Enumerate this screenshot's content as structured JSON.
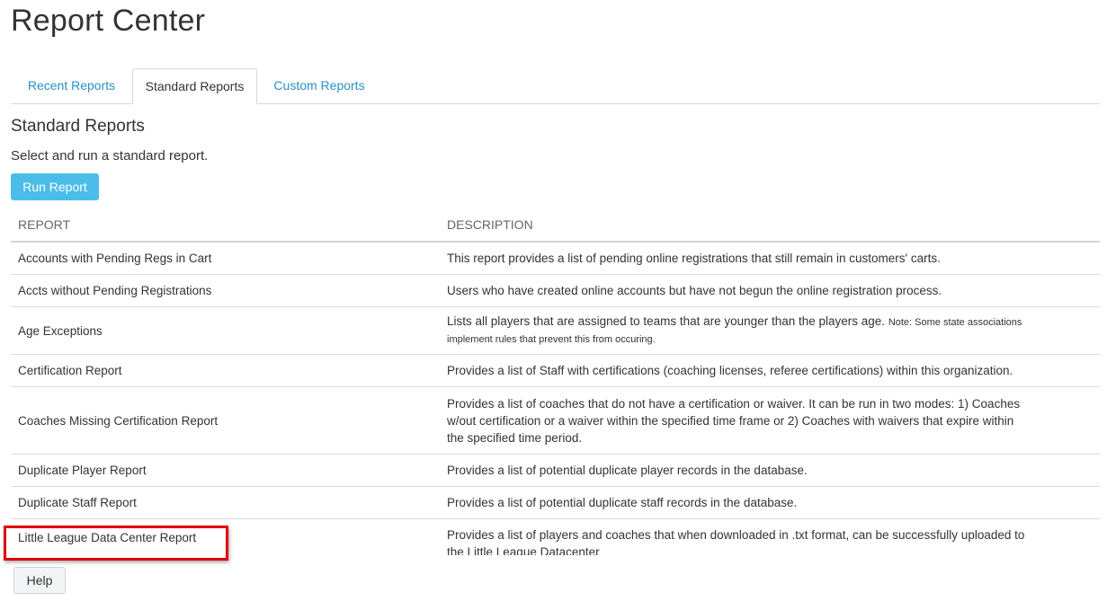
{
  "page": {
    "title": "Report Center"
  },
  "tabs": [
    {
      "label": "Recent Reports",
      "active": false
    },
    {
      "label": "Standard Reports",
      "active": true
    },
    {
      "label": "Custom Reports",
      "active": false
    }
  ],
  "section": {
    "title": "Standard Reports",
    "description": "Select and run a standard report.",
    "run_button": "Run Report"
  },
  "table": {
    "headers": {
      "report": "REPORT",
      "description": "DESCRIPTION"
    },
    "rows": [
      {
        "report": "Accounts with Pending Regs in Cart",
        "description": "This report provides a list of pending online registrations that still remain in customers' carts."
      },
      {
        "report": "Accts without Pending Registrations",
        "description": "Users who have created online accounts but have not begun the online registration process."
      },
      {
        "report": "Age Exceptions",
        "description": "Lists all players that are assigned to teams that are younger than the players age.",
        "note": "Note: Some state associations implement rules that prevent this from occuring."
      },
      {
        "report": "Certification Report",
        "description": "Provides a list of Staff with certifications (coaching licenses, referee certifications) within this organization."
      },
      {
        "report": "Coaches Missing Certification Report",
        "description": "Provides a list of coaches that do not have a certification or waiver. It can be run in two modes: 1) Coaches w/out certification or a waiver within the specified time frame or 2) Coaches with waivers that expire within the specified time period."
      },
      {
        "report": "Duplicate Player Report",
        "description": "Provides a list of potential duplicate player records in the database."
      },
      {
        "report": "Duplicate Staff Report",
        "description": "Provides a list of potential duplicate staff records in the database."
      },
      {
        "report": "Little League Data Center Report",
        "description": "Provides a list of players and coaches that when downloaded in .txt format, can be successfully uploaded to the Little League Datacenter"
      }
    ]
  },
  "footer": {
    "help_button": "Help"
  },
  "colors": {
    "accent": "#4bbde9",
    "link": "#2a8fc7",
    "highlight": "#e00000"
  }
}
